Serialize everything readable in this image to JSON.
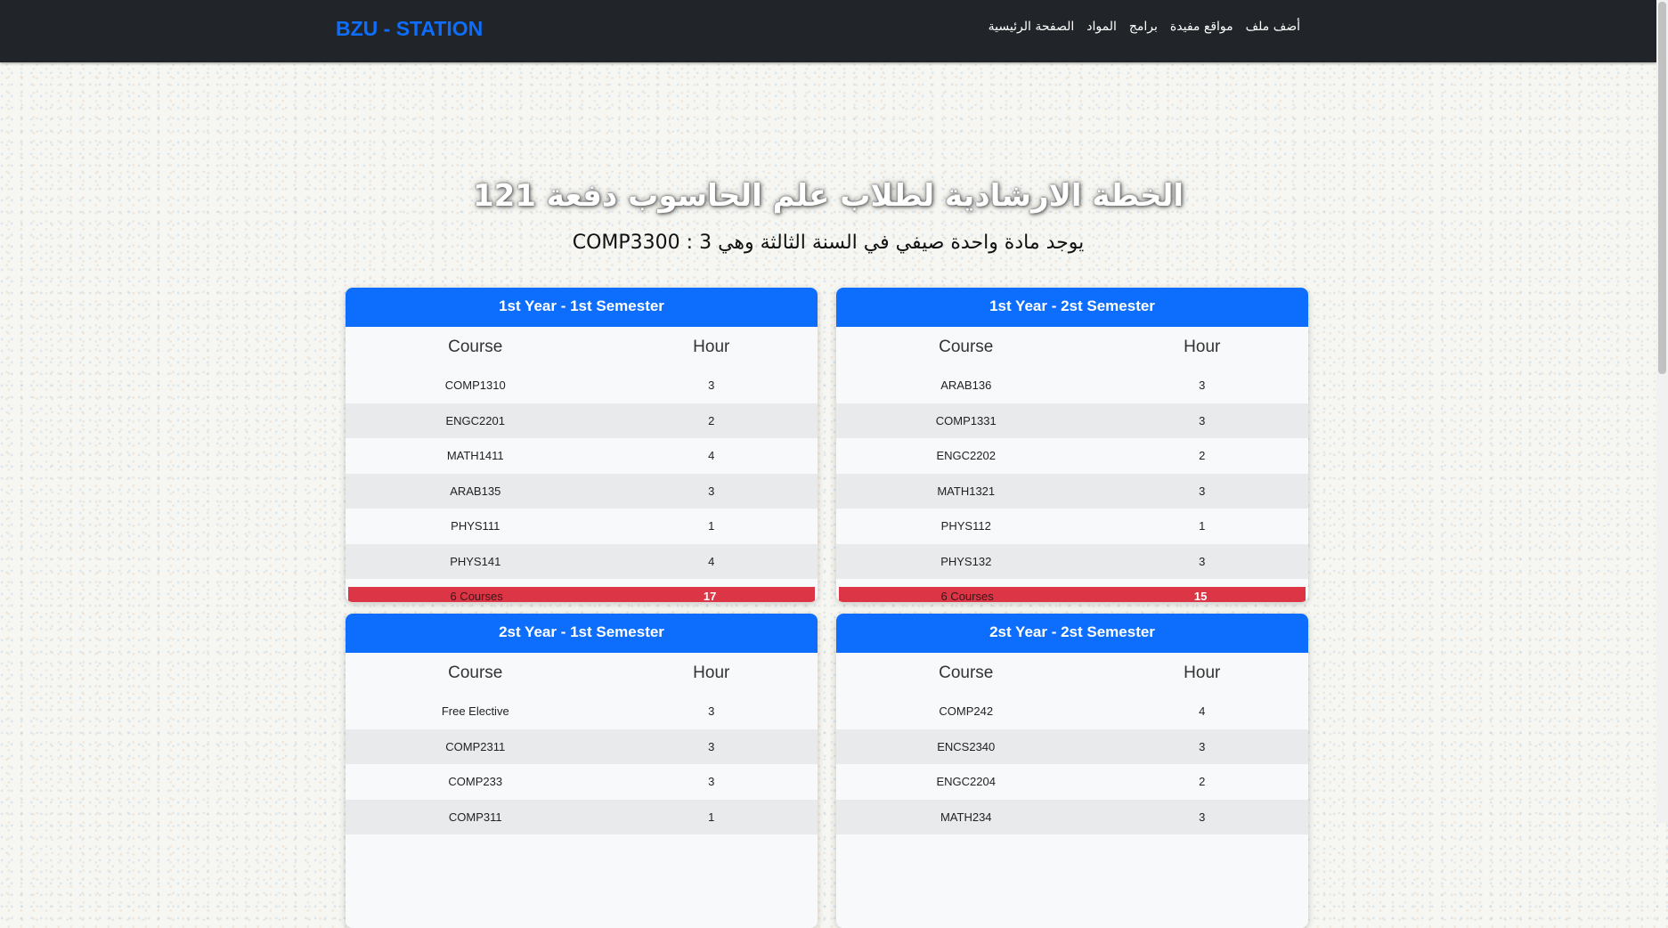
{
  "nav": {
    "brand": "BZU - STATION",
    "links": [
      "أضف ملف",
      "مواقع مفيدة",
      "برامج",
      "المواد",
      "الصفحة الرئيسية"
    ]
  },
  "page": {
    "title": "الخطة الارشادية لطلاب علم الحاسوب دفعة 121",
    "subtitle": "يوجد مادة واحدة صيفي في السنة الثالثة وهي 3 : COMP3300"
  },
  "table_headers": {
    "course": "Course",
    "hour": "Hour"
  },
  "semesters": [
    {
      "title": "1st Year - 1st Semester",
      "courses": [
        {
          "course": "COMP1310",
          "hour": "3"
        },
        {
          "course": "ENGC2201",
          "hour": "2"
        },
        {
          "course": "MATH1411",
          "hour": "4"
        },
        {
          "course": "ARAB135",
          "hour": "3"
        },
        {
          "course": "PHYS111",
          "hour": "1"
        },
        {
          "course": "PHYS141",
          "hour": "4"
        }
      ],
      "total_label": "6 Courses",
      "total_hours": "17"
    },
    {
      "title": "1st Year - 2st Semester",
      "courses": [
        {
          "course": "ARAB136",
          "hour": "3"
        },
        {
          "course": "COMP1331",
          "hour": "3"
        },
        {
          "course": "ENGC2202",
          "hour": "2"
        },
        {
          "course": "MATH1321",
          "hour": "3"
        },
        {
          "course": "PHYS112",
          "hour": "1"
        },
        {
          "course": "PHYS132",
          "hour": "3"
        }
      ],
      "total_label": "6 Courses",
      "total_hours": "15"
    },
    {
      "title": "2st Year - 1st Semester",
      "courses": [
        {
          "course": "Free Elective",
          "hour": "3"
        },
        {
          "course": "COMP2311",
          "hour": "3"
        },
        {
          "course": "COMP233",
          "hour": "3"
        },
        {
          "course": "COMP311",
          "hour": "1"
        }
      ]
    },
    {
      "title": "2st Year - 2st Semester",
      "courses": [
        {
          "course": "COMP242",
          "hour": "4"
        },
        {
          "course": "ENCS2340",
          "hour": "3"
        },
        {
          "course": "ENGC2204",
          "hour": "2"
        },
        {
          "course": "MATH234",
          "hour": "3"
        }
      ]
    }
  ],
  "colors": {
    "navbar": "#212529",
    "brand": "#0d6efd",
    "card_header": "#0d6efd",
    "total_bar": "#dc3545"
  }
}
